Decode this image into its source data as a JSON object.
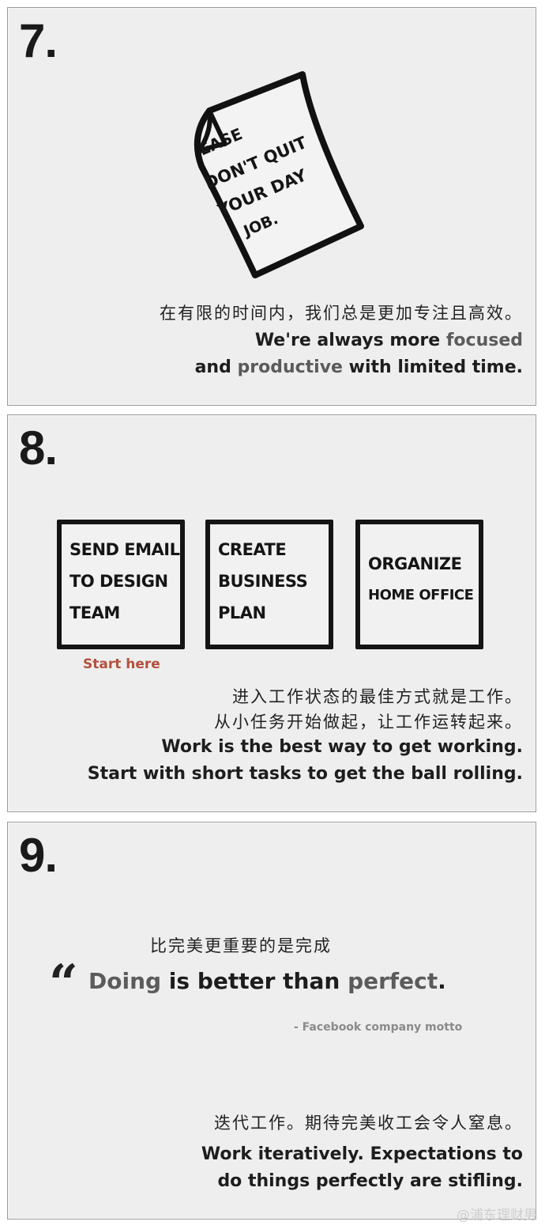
{
  "slide7": {
    "number": "7.",
    "note_lines": [
      "EASE",
      "DON'T QUIT",
      "YOUR DAY",
      "JOB."
    ],
    "chinese": "在有限的时间内，我们总是更加专注且高效。",
    "english_line1_a": "We're always more ",
    "english_line1_hl": "focused",
    "english_line2_a": "and ",
    "english_line2_hl": "productive",
    "english_line2_b": " with limited time."
  },
  "slide8": {
    "number": "8.",
    "tasks": [
      {
        "lines": [
          "Send email",
          "to design",
          "team"
        ]
      },
      {
        "lines": [
          "Create",
          "business",
          "plan"
        ]
      },
      {
        "lines": [
          "Organize",
          "home office"
        ]
      }
    ],
    "start_label": "Start here",
    "chinese_line1": "进入工作状态的最佳方式就是工作。",
    "chinese_line2": "从小任务开始做起，让工作运转起来。",
    "english_line1": "Work is the best way to get working.",
    "english_line2": "Start with short tasks to get the ball rolling."
  },
  "slide9": {
    "number": "9.",
    "chinese_top": "比完美更重要的是完成",
    "quote_mark": "“",
    "quote_hl1": "Doing",
    "quote_mid": " is better than ",
    "quote_hl2": "perfect",
    "quote_end": ".",
    "attribution": "- Facebook company motto",
    "chinese_bottom": "迭代工作。期待完美收工会令人窒息。",
    "english_line1": "Work iteratively. Expectations to",
    "english_line2": "do things perfectly are stifling."
  },
  "watermark": "@浦东理财男",
  "colors": {
    "card_bg": "#eeeeee",
    "highlight_gray": "#5b5b5b",
    "start_red": "#b4503d"
  }
}
